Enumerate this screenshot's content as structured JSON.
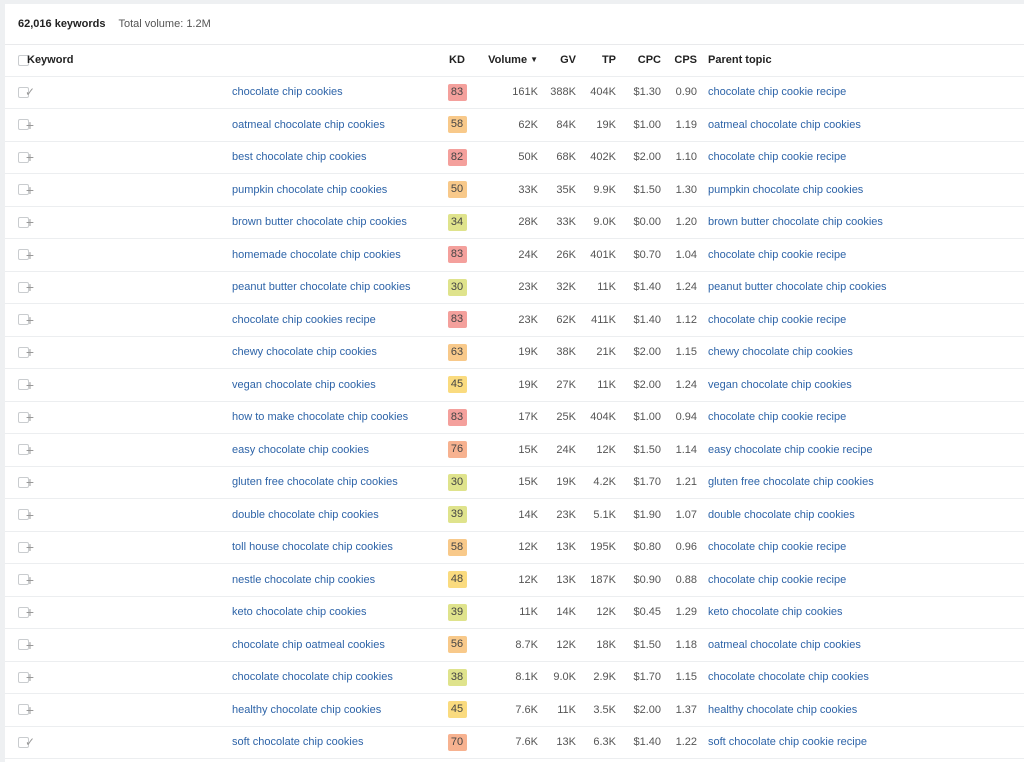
{
  "summary": {
    "count": "62,016 keywords",
    "total": "Total volume: 1.2M"
  },
  "colors": {
    "link": "#2e64a8",
    "kd_red": "#f4a09c",
    "kd_orange_red": "#f7b290",
    "kd_orange": "#f8c98a",
    "kd_yellow": "#fadb7f",
    "kd_olive": "#dfe38c"
  },
  "columns": {
    "keyword": "Keyword",
    "kd": "KD",
    "volume": "Volume",
    "volume_sort_icon": "sort-desc-icon",
    "gv": "GV",
    "tp": "TP",
    "cpc": "CPC",
    "cps": "CPS",
    "parent_topic": "Parent topic"
  },
  "rows": [
    {
      "keyword": "chocolate chip cookies",
      "action": "check",
      "kd": "83",
      "volume": "161K",
      "gv": "388K",
      "tp": "404K",
      "cpc": "$1.30",
      "cps": "0.90",
      "parent_topic": "chocolate chip cookie recipe"
    },
    {
      "keyword": "oatmeal chocolate chip cookies",
      "action": "plus",
      "kd": "58",
      "volume": "62K",
      "gv": "84K",
      "tp": "19K",
      "cpc": "$1.00",
      "cps": "1.19",
      "parent_topic": "oatmeal chocolate chip cookies"
    },
    {
      "keyword": "best chocolate chip cookies",
      "action": "plus",
      "kd": "82",
      "volume": "50K",
      "gv": "68K",
      "tp": "402K",
      "cpc": "$2.00",
      "cps": "1.10",
      "parent_topic": "chocolate chip cookie recipe"
    },
    {
      "keyword": "pumpkin chocolate chip cookies",
      "action": "plus",
      "kd": "50",
      "volume": "33K",
      "gv": "35K",
      "tp": "9.9K",
      "cpc": "$1.50",
      "cps": "1.30",
      "parent_topic": "pumpkin chocolate chip cookies"
    },
    {
      "keyword": "brown butter chocolate chip cookies",
      "action": "plus",
      "kd": "34",
      "volume": "28K",
      "gv": "33K",
      "tp": "9.0K",
      "cpc": "$0.00",
      "cps": "1.20",
      "parent_topic": "brown butter chocolate chip cookies"
    },
    {
      "keyword": "homemade chocolate chip cookies",
      "action": "plus",
      "kd": "83",
      "volume": "24K",
      "gv": "26K",
      "tp": "401K",
      "cpc": "$0.70",
      "cps": "1.04",
      "parent_topic": "chocolate chip cookie recipe"
    },
    {
      "keyword": "peanut butter chocolate chip cookies",
      "action": "plus",
      "kd": "30",
      "volume": "23K",
      "gv": "32K",
      "tp": "11K",
      "cpc": "$1.40",
      "cps": "1.24",
      "parent_topic": "peanut butter chocolate chip cookies"
    },
    {
      "keyword": "chocolate chip cookies recipe",
      "action": "plus",
      "kd": "83",
      "volume": "23K",
      "gv": "62K",
      "tp": "411K",
      "cpc": "$1.40",
      "cps": "1.12",
      "parent_topic": "chocolate chip cookie recipe"
    },
    {
      "keyword": "chewy chocolate chip cookies",
      "action": "plus",
      "kd": "63",
      "volume": "19K",
      "gv": "38K",
      "tp": "21K",
      "cpc": "$2.00",
      "cps": "1.15",
      "parent_topic": "chewy chocolate chip cookies"
    },
    {
      "keyword": "vegan chocolate chip cookies",
      "action": "plus",
      "kd": "45",
      "volume": "19K",
      "gv": "27K",
      "tp": "11K",
      "cpc": "$2.00",
      "cps": "1.24",
      "parent_topic": "vegan chocolate chip cookies"
    },
    {
      "keyword": "how to make chocolate chip cookies",
      "action": "plus",
      "kd": "83",
      "volume": "17K",
      "gv": "25K",
      "tp": "404K",
      "cpc": "$1.00",
      "cps": "0.94",
      "parent_topic": "chocolate chip cookie recipe"
    },
    {
      "keyword": "easy chocolate chip cookies",
      "action": "plus",
      "kd": "76",
      "volume": "15K",
      "gv": "24K",
      "tp": "12K",
      "cpc": "$1.50",
      "cps": "1.14",
      "parent_topic": "easy chocolate chip cookie recipe"
    },
    {
      "keyword": "gluten free chocolate chip cookies",
      "action": "plus",
      "kd": "30",
      "volume": "15K",
      "gv": "19K",
      "tp": "4.2K",
      "cpc": "$1.70",
      "cps": "1.21",
      "parent_topic": "gluten free chocolate chip cookies"
    },
    {
      "keyword": "double chocolate chip cookies",
      "action": "plus",
      "kd": "39",
      "volume": "14K",
      "gv": "23K",
      "tp": "5.1K",
      "cpc": "$1.90",
      "cps": "1.07",
      "parent_topic": "double chocolate chip cookies"
    },
    {
      "keyword": "toll house chocolate chip cookies",
      "action": "plus",
      "kd": "58",
      "volume": "12K",
      "gv": "13K",
      "tp": "195K",
      "cpc": "$0.80",
      "cps": "0.96",
      "parent_topic": "chocolate chip cookie recipe"
    },
    {
      "keyword": "nestle chocolate chip cookies",
      "action": "plus",
      "kd": "48",
      "volume": "12K",
      "gv": "13K",
      "tp": "187K",
      "cpc": "$0.90",
      "cps": "0.88",
      "parent_topic": "chocolate chip cookie recipe"
    },
    {
      "keyword": "keto chocolate chip cookies",
      "action": "plus",
      "kd": "39",
      "volume": "11K",
      "gv": "14K",
      "tp": "12K",
      "cpc": "$0.45",
      "cps": "1.29",
      "parent_topic": "keto chocolate chip cookies"
    },
    {
      "keyword": "chocolate chip oatmeal cookies",
      "action": "plus",
      "kd": "56",
      "volume": "8.7K",
      "gv": "12K",
      "tp": "18K",
      "cpc": "$1.50",
      "cps": "1.18",
      "parent_topic": "oatmeal chocolate chip cookies"
    },
    {
      "keyword": "chocolate chocolate chip cookies",
      "action": "plus",
      "kd": "38",
      "volume": "8.1K",
      "gv": "9.0K",
      "tp": "2.9K",
      "cpc": "$1.70",
      "cps": "1.15",
      "parent_topic": "chocolate chocolate chip cookies"
    },
    {
      "keyword": "healthy chocolate chip cookies",
      "action": "plus",
      "kd": "45",
      "volume": "7.6K",
      "gv": "11K",
      "tp": "3.5K",
      "cpc": "$2.00",
      "cps": "1.37",
      "parent_topic": "healthy chocolate chip cookies"
    },
    {
      "keyword": "soft chocolate chip cookies",
      "action": "check",
      "kd": "70",
      "volume": "7.6K",
      "gv": "13K",
      "tp": "6.3K",
      "cpc": "$1.40",
      "cps": "1.22",
      "parent_topic": "soft chocolate chip cookie recipe"
    }
  ]
}
